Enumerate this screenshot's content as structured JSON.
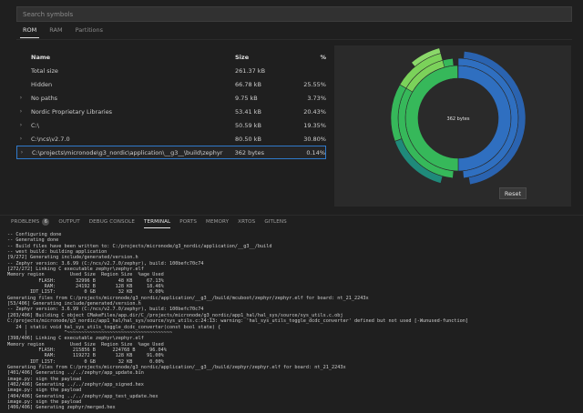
{
  "search": {
    "placeholder": "Search symbols"
  },
  "tabs": [
    "ROM",
    "RAM",
    "Partitions"
  ],
  "table": {
    "headers": {
      "name": "Name",
      "size": "Size",
      "percent": "%"
    },
    "rows": [
      {
        "name": "Total size",
        "size": "261.37 kB",
        "percent": "",
        "expandable": false
      },
      {
        "name": "Hidden",
        "size": "66.78 kB",
        "percent": "25.55%",
        "expandable": false
      },
      {
        "name": "No paths",
        "size": "9.75 kB",
        "percent": "3.73%",
        "expandable": true
      },
      {
        "name": "Nordic Proprietary Libraries",
        "size": "53.41 kB",
        "percent": "20.43%",
        "expandable": true
      },
      {
        "name": "C:\\",
        "size": "50.59 kB",
        "percent": "19.35%",
        "expandable": true
      },
      {
        "name": "C:\\ncs\\v2.7.0",
        "size": "80.50 kB",
        "percent": "30.80%",
        "expandable": true
      },
      {
        "name": "C:\\projects\\micronode\\g3_nordic\\application\\__g3__\\build\\zephyr",
        "size": "362 bytes",
        "percent": "0.14%",
        "expandable": true,
        "selected": true
      }
    ]
  },
  "chart": {
    "center_label": "362 bytes",
    "reset_label": "Reset"
  },
  "panel_tabs": [
    {
      "label": "PROBLEMS",
      "badge": "6"
    },
    {
      "label": "OUTPUT"
    },
    {
      "label": "DEBUG CONSOLE"
    },
    {
      "label": "TERMINAL",
      "active": true
    },
    {
      "label": "PORTS"
    },
    {
      "label": "MEMORY"
    },
    {
      "label": "XRTOS"
    },
    {
      "label": "GITLENS"
    }
  ],
  "terminal_lines": [
    "-- Configuring done",
    "-- Generating done",
    "-- Build files have been written to: C:/projects/micronode/g3_nordic/application/__g3__/build",
    "-- west build: building application",
    "[9/272] Generating include/generated/version.h",
    "-- Zephyr version: 3.6.99 (C:/ncs/v2.7.0/zephyr), build: 100befc70c74",
    "[272/272] Linking C executable zephyr\\zephyr.elf",
    "Memory region         Used Size  Region Size  %age Used",
    "           FLASH:       32996 B        48 KB     67.13%",
    "             RAM:       24192 B       128 KB     18.46%",
    "        IDT_LIST:          0 GB        32 KB      0.00%",
    "Generating files from C:/projects/micronode/g3_nordic/application/__g3__/build/mcuboot/zephyr/zephyr.elf for board: nt_21_2243x",
    "[53/406] Generating include/generated/version.h",
    "-- Zephyr version: 3.6.99 (C:/ncs/v2.7.0/zephyr), build: 100befc70c74",
    "[203/406] Building C object CMakeFiles/app.dir/C_/projects/micronode/g3_nordic/app1_hal/hal_sys/source/sys_utils.c.obj",
    "C:/projects/micronode/g3_nordic/app1_hal/hal_sys/source/sys_utils.c:24:13: warning: 'hal_sys_utils_toggle_dcdc_converter' defined but not used [-Wunused-function]",
    "   24 | static void hal_sys_utils_toggle_dcdc_converter(const bool state) {",
    "      |             ^~~~~~~~~~~~~~~~~~~~~~~~~~~~~~~~~~~~~~",
    "[398/406] Linking C executable zephyr\\zephyr.elf",
    "Memory region         Used Size  Region Size  %age Used",
    "           FLASH:      215856 B      224768 B     96.04%",
    "             RAM:      119272 B       128 KB     91.00%",
    "        IDT_LIST:          0 GB        32 KB      0.00%",
    "Generating files from C:/projects/micronode/g3_nordic/application/__g3__/build/zephyr/zephyr.elf for board: nt_21_2243x",
    "[401/406] Generating ../../zephyr/app_update.bin",
    "image.py: sign the payload",
    "[402/406] Generating ../../zephyr/app_signed.hex",
    "image.py: sign the payload",
    "[404/406] Generating ../../zephyr/app_test_update.hex",
    "image.py: sign the payload",
    "[406/406] Generating zephyr/merged.hex"
  ],
  "colors": {
    "blue": "#2f6fc0",
    "green": "#36b85a",
    "lightgreen": "#7bd25a",
    "teal": "#1f8a7a",
    "accent": "#2f7acb"
  }
}
